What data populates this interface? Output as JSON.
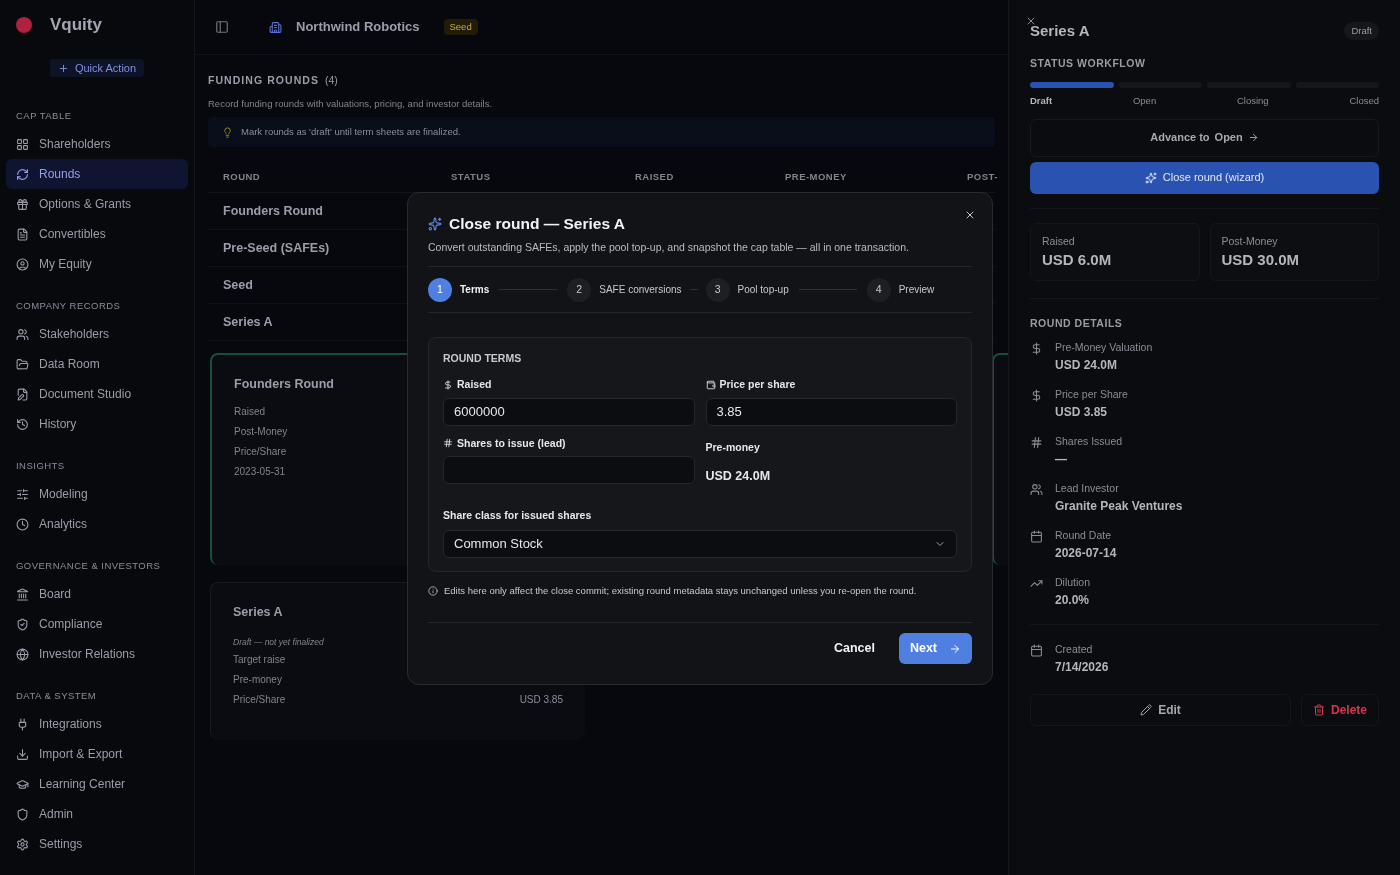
{
  "sidebar": {
    "logo": "Vquity",
    "quick_action": "Quick Action",
    "sections": [
      {
        "title": "CAP TABLE",
        "items": [
          {
            "label": "Shareholders",
            "selected": false
          },
          {
            "label": "Rounds",
            "selected": true
          },
          {
            "label": "Options & Grants",
            "selected": false
          },
          {
            "label": "Convertibles",
            "selected": false
          },
          {
            "label": "My Equity",
            "selected": false
          }
        ]
      },
      {
        "title": "COMPANY RECORDS",
        "items": [
          {
            "label": "Stakeholders",
            "selected": false
          },
          {
            "label": "Data Room",
            "selected": false
          },
          {
            "label": "Document Studio",
            "selected": false
          },
          {
            "label": "History",
            "selected": false
          }
        ]
      },
      {
        "title": "INSIGHTS",
        "items": [
          {
            "label": "Modeling",
            "selected": false
          },
          {
            "label": "Analytics",
            "selected": false
          }
        ]
      },
      {
        "title": "GOVERNANCE & INVESTORS",
        "items": [
          {
            "label": "Board",
            "selected": false
          },
          {
            "label": "Compliance",
            "selected": false
          },
          {
            "label": "Investor Relations",
            "selected": false
          }
        ]
      },
      {
        "title": "DATA & SYSTEM",
        "items": [
          {
            "label": "Integrations",
            "selected": false
          },
          {
            "label": "Import & Export",
            "selected": false
          },
          {
            "label": "Learning Center",
            "selected": false
          },
          {
            "label": "Admin",
            "selected": false
          },
          {
            "label": "Settings",
            "selected": false
          }
        ]
      }
    ]
  },
  "topbar": {
    "company": "Northwind Robotics",
    "stage_badge": "Seed"
  },
  "page": {
    "title": "FUNDING ROUNDS",
    "count": "(4)",
    "subtitle": "Record funding rounds with valuations, pricing, and investor details.",
    "tip": "Mark rounds as 'draft' until term sheets are finalized."
  },
  "table": {
    "columns": [
      "ROUND",
      "STATUS",
      "RAISED",
      "PRE-MONEY",
      "POST-"
    ],
    "rows": [
      {
        "round": "Founders Round"
      },
      {
        "round": "Pre-Seed (SAFEs)"
      },
      {
        "round": "Seed"
      },
      {
        "round": "Series A"
      }
    ]
  },
  "cards": [
    {
      "title": "Founders Round",
      "lines": [
        "Raised",
        "Post-Money",
        "Price/Share",
        "2023-05-31"
      ],
      "finalized": true
    },
    {
      "title": "Series A",
      "note": "Draft — not yet finalized",
      "lines": [
        "Target raise",
        "Pre-money",
        "Price/Share"
      ],
      "value": "USD 3.85",
      "finalized": false
    }
  ],
  "panel": {
    "title": "Series A",
    "status_badge": "Draft",
    "workflow_title": "STATUS WORKFLOW",
    "stages": [
      {
        "label": "Draft",
        "selected": true
      },
      {
        "label": "Open",
        "selected": false
      },
      {
        "label": "Closing",
        "selected": false
      },
      {
        "label": "Closed",
        "selected": false
      }
    ],
    "advance_label": "Advance to",
    "advance_target": "Open",
    "wizard_button": "Close round (wizard)",
    "stats": [
      {
        "label": "Raised",
        "value": "USD 6.0M"
      },
      {
        "label": "Post-Money",
        "value": "USD 30.0M"
      }
    ],
    "details_title": "ROUND DETAILS",
    "details": [
      {
        "label": "Pre-Money Valuation",
        "value": "USD 24.0M"
      },
      {
        "label": "Price per Share",
        "value": "USD 3.85"
      },
      {
        "label": "Shares Issued",
        "value": "—"
      },
      {
        "label": "Lead Investor",
        "value": "Granite Peak Ventures"
      },
      {
        "label": "Round Date",
        "value": "2026-07-14"
      },
      {
        "label": "Dilution",
        "value": "20.0%"
      }
    ],
    "created": {
      "label": "Created",
      "value": "7/14/2026"
    },
    "edit": "Edit",
    "delete": "Delete"
  },
  "dialog": {
    "title": "Close round — Series A",
    "description": "Convert outstanding SAFEs, apply the pool top-up, and snapshot the cap table — all in one transaction.",
    "steps": [
      {
        "number": "1",
        "label": "Terms",
        "selected": true
      },
      {
        "number": "2",
        "label": "SAFE conversions",
        "selected": false
      },
      {
        "number": "3",
        "label": "Pool top-up",
        "selected": false
      },
      {
        "number": "4",
        "label": "Preview",
        "selected": false
      }
    ],
    "section_title": "ROUND TERMS",
    "raised": {
      "label": "Raised",
      "value": "6000000"
    },
    "price": {
      "label": "Price per share",
      "value": "3.85"
    },
    "shares": {
      "label": "Shares to issue (lead)"
    },
    "pre_money": {
      "label": "Pre-money",
      "value": "USD 24.0M"
    },
    "share_class": {
      "label": "Share class for issued shares",
      "value": "Common Stock"
    },
    "note": "Edits here only affect the close commit; existing round metadata stays unchanged unless you re-open the round.",
    "cancel": "Cancel",
    "next": "Next"
  }
}
